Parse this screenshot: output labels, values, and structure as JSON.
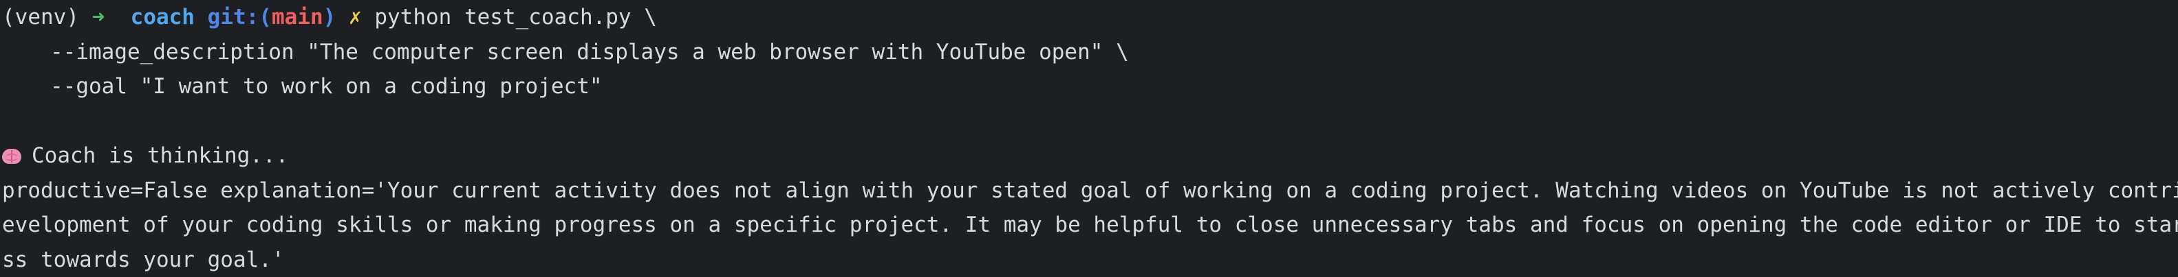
{
  "prompt": {
    "venv": "(venv)",
    "arrow": "➜",
    "directory": "coach",
    "git_open": "git:(",
    "branch": "main",
    "git_close": ")",
    "dirty_marker": "✗",
    "command": "python test_coach.py \\"
  },
  "args": [
    "--image_description \"The computer screen displays a web browser with YouTube open\" \\",
    "--goal \"I want to work on a coding project\""
  ],
  "status": {
    "icon": "brain-icon",
    "text": "Coach is thinking..."
  },
  "output_lines": [
    "productive=False explanation='Your current activity does not align with your stated goal of working on a coding project. Watching videos on YouTube is not actively contributing to the d",
    "evelopment of your coding skills or making progress on a specific project. It may be helpful to close unnecessary tabs and focus on opening the code editor or IDE to start making progre",
    "ss towards your goal.'"
  ],
  "colors": {
    "background": "#1d1f23",
    "text": "#d8dade",
    "arrow": "#4fc16b",
    "directory": "#51a8ee",
    "git_label": "#4f87e8",
    "branch": "#ef5f5f",
    "dirty_marker": "#f2cc4a"
  }
}
